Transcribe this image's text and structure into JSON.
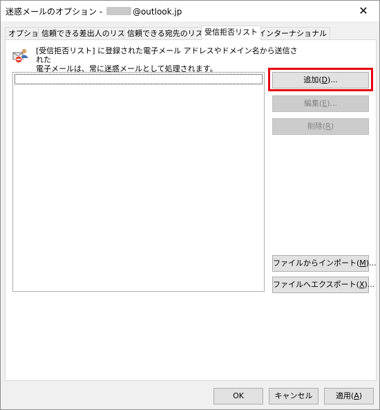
{
  "window": {
    "title_prefix": "迷惑メールのオプション - ",
    "title_suffix": "@outlook.jp",
    "close_glyph": "✕"
  },
  "tabs": [
    {
      "label": "オプション"
    },
    {
      "label": "信頼できる差出人のリスト"
    },
    {
      "label": "信頼できる宛先のリスト"
    },
    {
      "label": "受信拒否リスト",
      "active": true
    },
    {
      "label": "インターナショナル"
    }
  ],
  "panel": {
    "description_line1": "[受信拒否リスト] に登録された電子メール アドレスやドメイン名から送信された",
    "description_line2": "電子メールは、常に迷惑メールとして処理されます。",
    "icon": "blocked-senders-icon"
  },
  "buttons": {
    "add": {
      "label": "追加(",
      "key": "D",
      "suffix": ")..."
    },
    "edit": {
      "label": "編集(",
      "key": "E",
      "suffix": ")..."
    },
    "delete": {
      "label": "削除(",
      "key": "R",
      "suffix": ")"
    },
    "import": {
      "label": "ファイルからインポート(",
      "key": "M",
      "suffix": ")..."
    },
    "export": {
      "label": "ファイルへエクスポート(",
      "key": "X",
      "suffix": ")..."
    }
  },
  "footer": {
    "ok": "OK",
    "cancel": "キャンセル",
    "apply": {
      "label": "適用(",
      "key": "A",
      "suffix": ")"
    }
  },
  "colors": {
    "highlight": "#e60012"
  }
}
